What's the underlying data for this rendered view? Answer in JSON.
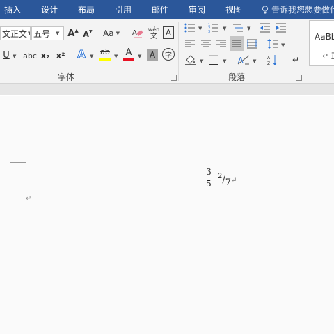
{
  "tabs": [
    {
      "label": "插入"
    },
    {
      "label": "设计"
    },
    {
      "label": "布局"
    },
    {
      "label": "引用"
    },
    {
      "label": "邮件"
    },
    {
      "label": "审阅"
    },
    {
      "label": "视图"
    }
  ],
  "tell_me": {
    "text": "告诉我您想要做什"
  },
  "font": {
    "font_name": "文正文",
    "font_size": "五号",
    "grow_label": "A",
    "shrink_label": "A",
    "change_case_label": "Aa",
    "phonetic_top": "wén",
    "phonetic_bottom": "文",
    "char_border_label": "A",
    "underline_label": "U",
    "strike_label": "abc",
    "subscript_label": "x₂",
    "superscript_label": "x²",
    "text_effect_label": "A",
    "highlight_label": "ab",
    "font_color_label": "A",
    "char_shading_label": "A",
    "enclose_label": "字",
    "highlight_color": "#ffff00",
    "font_color": "#e81123",
    "group_label": "字体"
  },
  "paragraph": {
    "group_label": "段落"
  },
  "styles": {
    "preview_label": "AaBb",
    "second_label": "↵ 正"
  },
  "document": {
    "stacked_fraction": {
      "numerator": "3",
      "denominator": "5"
    },
    "slash_fraction": {
      "numerator": "2",
      "slash": "/",
      "denominator": "7"
    },
    "paragraph_mark": "↵"
  },
  "colors": {
    "accent": "#2b579a",
    "ribbon_bg": "#f3f3f3",
    "doc_bg": "#fafafa"
  }
}
